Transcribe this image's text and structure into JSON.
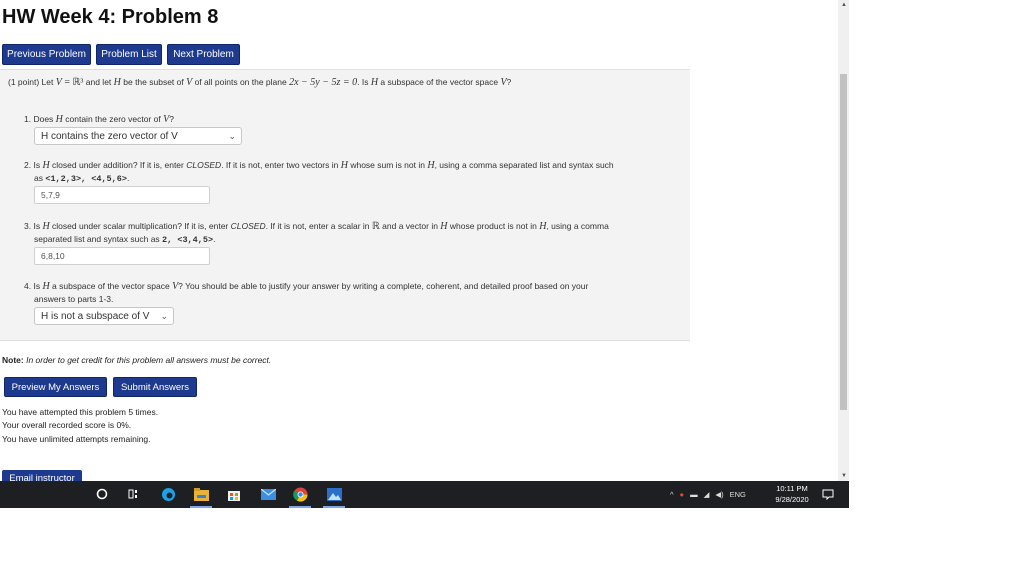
{
  "page": {
    "title": "HW Week 4: Problem 8"
  },
  "nav": {
    "previous": "Previous Problem",
    "list": "Problem List",
    "next": "Next Problem"
  },
  "problem": {
    "intro_1": "(1 point) Let ",
    "intro_V": "V",
    "intro_eq": " = ",
    "intro_R3": "ℝ³",
    "intro_2": " and let ",
    "intro_H": "H",
    "intro_3": " be the subset of ",
    "intro_V2": "V",
    "intro_4": " of all points on the plane ",
    "intro_plane": "2x − 5y − 5z = 0",
    "intro_5": ". Is ",
    "intro_H2": "H",
    "intro_6": " a subspace of the vector space ",
    "intro_V3": "V",
    "intro_7": "?",
    "q1": {
      "num": "1. ",
      "text_a": "Does ",
      "H": "H",
      "text_b": " contain the zero vector of ",
      "V": "V",
      "text_c": "?",
      "selected": "H contains the zero vector of V"
    },
    "q2": {
      "num": "2. ",
      "text_a": "Is ",
      "H": "H",
      "text_b": " closed under addition? If it is, enter ",
      "closed": "CLOSED",
      "text_c": ". If it is not, enter two vectors in ",
      "H2": "H",
      "text_d": " whose sum is not in ",
      "H3": "H",
      "text_e": ", using a comma separated list and syntax such",
      "text_f": "as ",
      "example": "<1,2,3>, <4,5,6>",
      "text_g": ".",
      "answer": "5,7,9"
    },
    "q3": {
      "num": "3. ",
      "text_a": "Is ",
      "H": "H",
      "text_b": " closed under scalar multiplication? If it is, enter ",
      "closed": "CLOSED",
      "text_c": ". If it is not, enter a scalar in ",
      "R": "ℝ",
      "text_d": " and a vector in ",
      "H2": "H",
      "text_e": " whose product is not in ",
      "H3": "H",
      "text_f": ", using a comma",
      "text_g": "separated list and syntax such as ",
      "example": "2, <3,4,5>",
      "text_h": ".",
      "answer": "6,8,10"
    },
    "q4": {
      "num": "4. ",
      "text_a": "Is ",
      "H": "H",
      "text_b": " a subspace of the vector space ",
      "V": "V",
      "text_c": "? You should be able to justify your answer by writing a complete, coherent, and detailed proof based on your",
      "text_d": "answers to parts 1-3.",
      "selected": "H is not a subspace of V"
    }
  },
  "note": {
    "label": "Note:",
    "text": " In order to get credit for this problem all answers must be correct."
  },
  "actions": {
    "preview": "Preview My Answers",
    "submit": "Submit Answers"
  },
  "status": {
    "attempted": "You have attempted this problem 5 times.",
    "score": "Your overall recorded score is 0%.",
    "remaining": "You have unlimited attempts remaining."
  },
  "email": "Email instructor",
  "taskbar": {
    "language": "ENG",
    "time": "10:11 PM",
    "date": "9/28/2020"
  }
}
